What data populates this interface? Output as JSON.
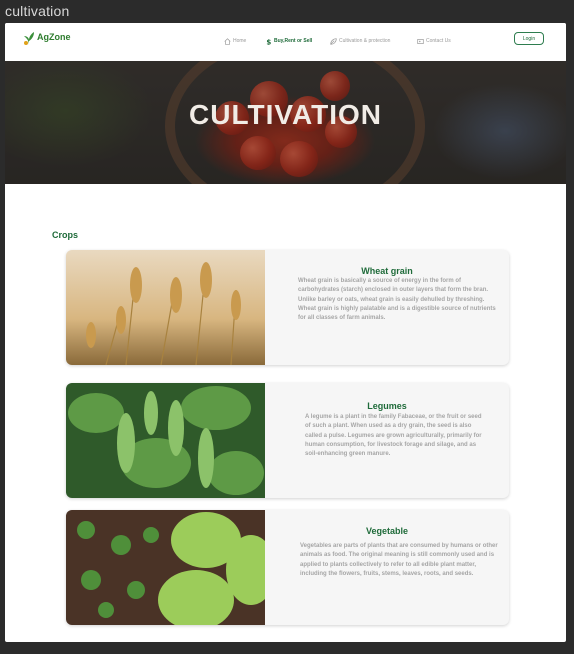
{
  "window": {
    "label": "cultivation"
  },
  "nav": {
    "logo_text": "AgZone",
    "items": [
      {
        "label": "Home",
        "icon": "home-icon",
        "active": false
      },
      {
        "label": "Buy,Rent or Sell",
        "icon": "dollar-icon",
        "active": true
      },
      {
        "label": "Cultivation & protection",
        "icon": "leaf-icon",
        "active": false
      },
      {
        "label": "Contact Us",
        "icon": "contact-icon",
        "active": false
      }
    ],
    "login_label": "Login"
  },
  "hero": {
    "title": "CULTIVATION"
  },
  "section": {
    "title": "Crops"
  },
  "cards": [
    {
      "title": "Wheat grain",
      "text": "Wheat grain is basically a source of energy in the form of carbohydrates (starch) enclosed in outer layers that form the bran. Unlike barley or oats, wheat grain is easily dehulled by threshing. Wheat grain is highly palatable and is a digestible source of nutrients for all classes of farm animals."
    },
    {
      "title": "Legumes",
      "text": "A legume is a plant in the family Fabaceae, or the fruit or seed of such a plant. When used as a dry grain, the seed is also called a pulse. Legumes are grown agriculturally, primarily for human consumption, for livestock forage and silage, and as soil-enhancing green manure."
    },
    {
      "title": "Vegetable",
      "text": "Vegetables are parts of plants that are consumed by humans or other animals as food. The original meaning is still commonly used and is applied to plants collectively to refer to all edible plant matter, including the flowers, fruits, stems, leaves, roots, and seeds."
    }
  ],
  "colors": {
    "brand_green": "#1f6b3a",
    "logo_orange": "#e0a21a",
    "muted_text": "#a6a6a6"
  }
}
